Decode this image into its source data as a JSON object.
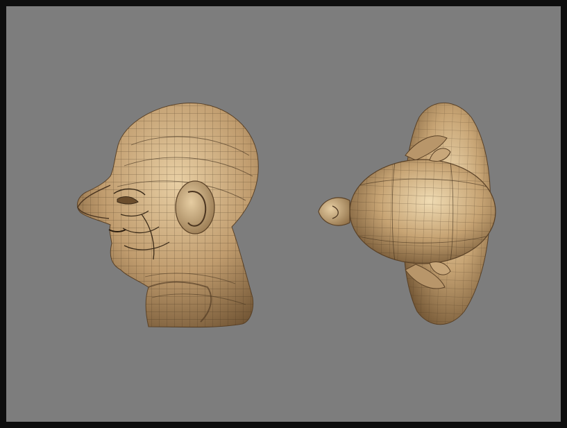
{
  "scene": {
    "background_color": "#7d7d7d",
    "border_color": "#0e0e0e",
    "model_color": "#c4a57c",
    "wire_color": "#3a2a18",
    "views": [
      {
        "name": "side-view",
        "subject": "old-man-head-profile"
      },
      {
        "name": "top-view",
        "subject": "old-man-head-from-above"
      }
    ]
  }
}
